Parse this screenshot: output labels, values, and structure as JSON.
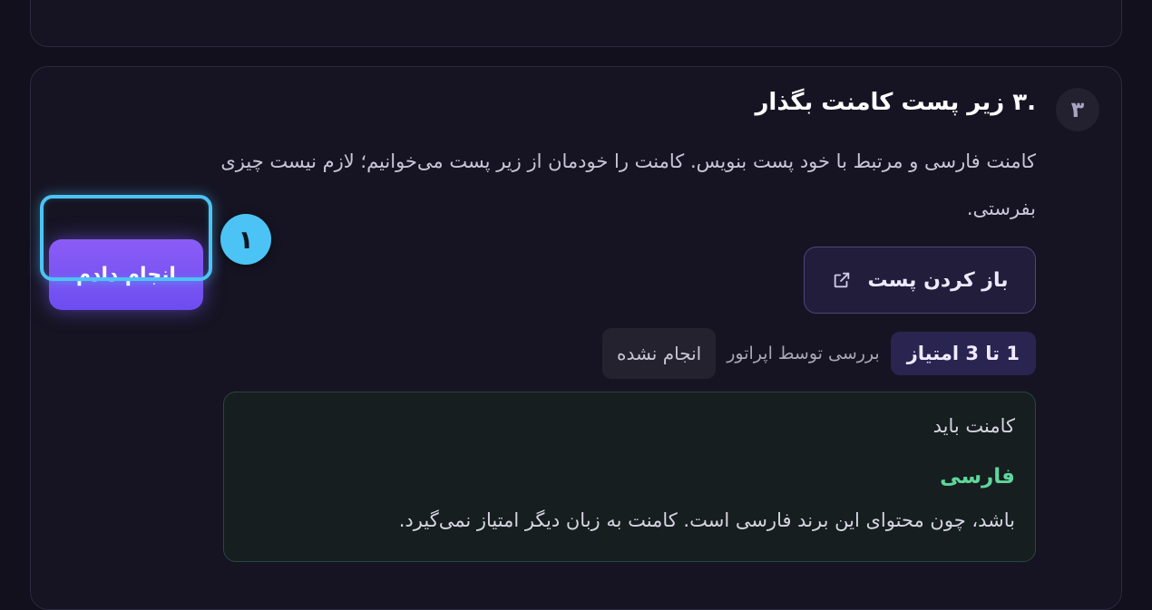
{
  "task": {
    "step_number": "۳",
    "title": ".۳ زیر پست کامنت بگذار",
    "description": "کامنت فارسی و مرتبط با خود پست بنویس. کامنت را خودمان از زیر پست می‌خوانیم؛ لازم نیست چیزی بفرستی.",
    "open_post_label": "باز کردن پست",
    "open_post_icon": "external-link-icon",
    "points_label": "1 تا 3 امتیاز",
    "review_label": "بررسی توسط اپراتور",
    "status_label": "انجام نشده",
    "note": {
      "line1": "کامنت باید",
      "highlight": "فارسی",
      "line3": "باشد، چون محتوای این برند فارسی است. کامنت به زبان دیگر امتیاز نمی‌گیرد."
    },
    "done_button_label": "انجام دادم"
  },
  "annotation": {
    "marker_label": "۱"
  },
  "colors": {
    "accent": "#8b5cf6",
    "highlight_border": "#4cc3f5",
    "success_text": "#5fd69a",
    "background": "#12101c"
  }
}
